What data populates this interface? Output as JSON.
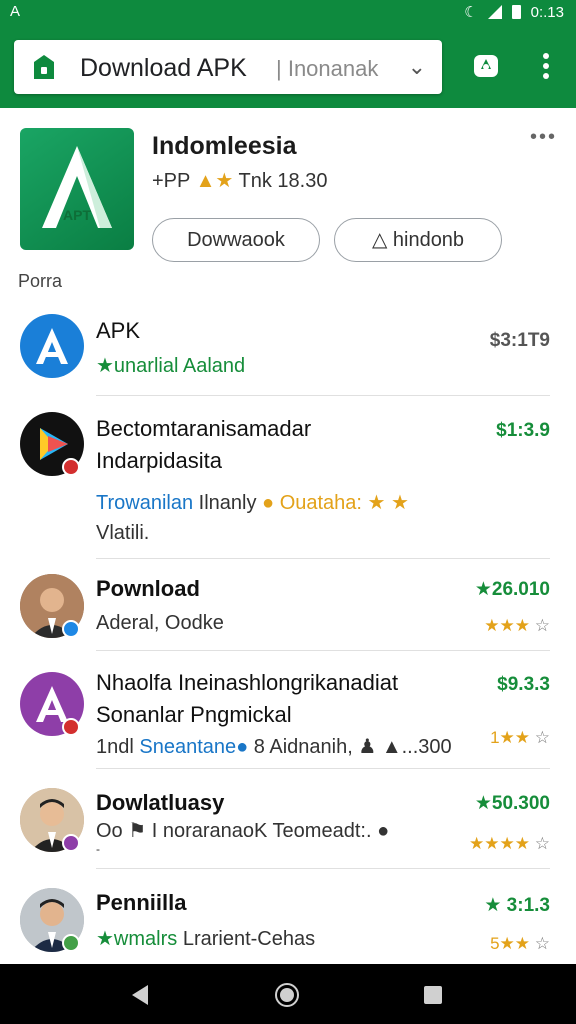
{
  "status_bar": {
    "left_icon": "A",
    "time": "0:.13"
  },
  "address_bar": {
    "title": "Download APK",
    "subtitle": "| Inonanak",
    "lock_icon": "lock-icon",
    "shield_icon": "shield-icon",
    "menu_icon": "more-vert-icon"
  },
  "featured": {
    "name": "Indomleesia",
    "meta_prefix": "+PP",
    "meta_suffix": "Tnk 18.30",
    "icon_label": "APT",
    "more": "•••",
    "download_label": "Dowwaook",
    "install_label": "hindonb",
    "section_label": "Porra"
  },
  "items": [
    {
      "title": "APK",
      "subtitle": "★unarlial Aaland",
      "price": "$3:1T9"
    },
    {
      "title": "Bectomtaranisamadar",
      "title2": "Indarpidasita",
      "line3_blue": "Trowanilan",
      "line3_rest": "Ilnanly",
      "line3_gold": "Ouataha:",
      "line4": "Vlatili.",
      "price": "$1:3.9"
    },
    {
      "title": "Pownload",
      "subtitle": "Aderal, Oodke",
      "price": "★26.010",
      "stars": "★★★"
    },
    {
      "title": "Nhaolfa Ineinashlongrikanadiat",
      "title2": "Sonanlar Pngmickal",
      "line3_a": "1ndl",
      "line3_blue": "Sneantane",
      "line3_rest": "8 Aidnanih,",
      "line3_tail": "...300",
      "price": "$9.3.3",
      "stars": "1★★"
    },
    {
      "title": "Dowlatluasy",
      "subtitle": "Oo ⚑ I noraranaoK Teomeadt:.",
      "subtitle2": "-",
      "price": "★50.300",
      "stars": "★★★★"
    },
    {
      "title": "Penniilla",
      "subtitle_green": "★wmalrs",
      "subtitle_rest": "Lrarient-Cehas",
      "price": "★ 3:1.3",
      "stars": "5★★"
    }
  ],
  "nav": {
    "back_icon": "back-icon",
    "home_icon": "home-icon",
    "recents_icon": "recents-icon"
  },
  "colors": {
    "brand_green": "#0e8a3e",
    "price_green": "#168d3a",
    "star_gold": "#e3a21a",
    "link_blue": "#1976c7"
  }
}
